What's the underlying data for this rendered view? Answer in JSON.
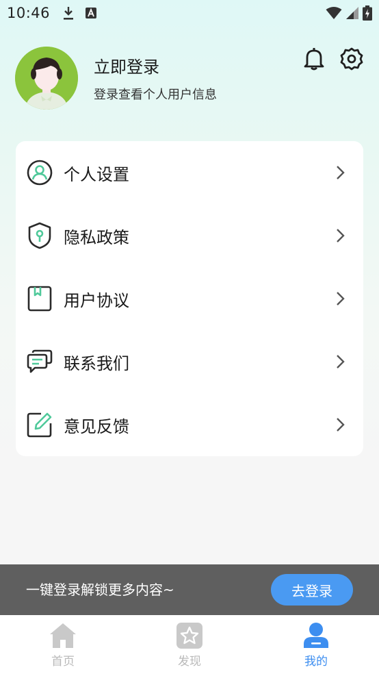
{
  "status_bar": {
    "time": "10:46",
    "icons": [
      "download-icon",
      "keyboard-a-icon",
      "wifi-icon",
      "signal-icon",
      "battery-charging-icon"
    ]
  },
  "profile": {
    "title": "立即登录",
    "subtitle": "登录查看个人用户信息",
    "avatar_bg": "#8bc43c"
  },
  "header_actions": {
    "notification_icon": "bell-icon",
    "settings_icon": "gear-icon"
  },
  "menu": {
    "items": [
      {
        "label": "个人设置",
        "icon": "user-profile-icon"
      },
      {
        "label": "隐私政策",
        "icon": "shield-icon"
      },
      {
        "label": "用户协议",
        "icon": "agreement-book-icon"
      },
      {
        "label": "联系我们",
        "icon": "chat-bubbles-icon"
      },
      {
        "label": "意见反馈",
        "icon": "edit-feedback-icon"
      }
    ]
  },
  "login_banner": {
    "text": "一键登录解锁更多内容~",
    "button_label": "去登录",
    "button_color": "#4a9af2"
  },
  "bottom_nav": {
    "tabs": [
      {
        "label": "首页",
        "icon": "home-icon",
        "active": false
      },
      {
        "label": "发现",
        "icon": "star-icon",
        "active": false
      },
      {
        "label": "我的",
        "icon": "person-icon",
        "active": true
      }
    ],
    "active_color": "#3d8ef0",
    "inactive_color": "#b9b9b9"
  },
  "colors": {
    "accent_green": "#4fc99a",
    "icon_dark": "#2a2a2a"
  }
}
